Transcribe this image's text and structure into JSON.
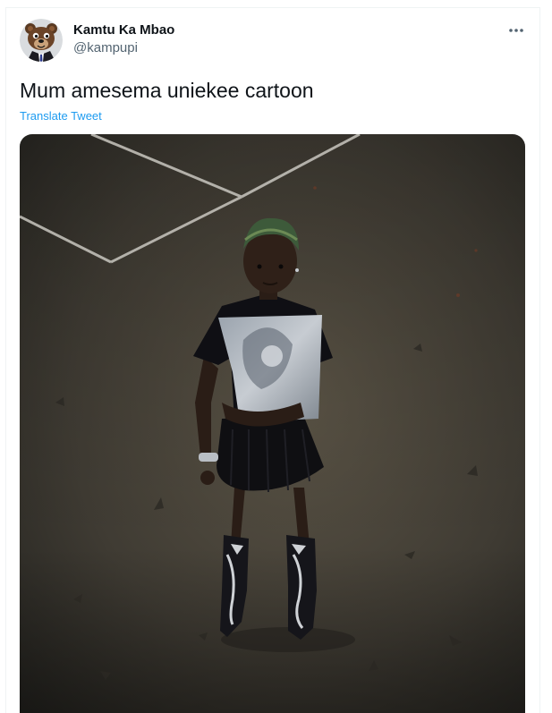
{
  "tweet": {
    "author": {
      "display_name": "Kamtu Ka Mbao",
      "handle": "@kampupi",
      "avatar_icon": "bear-avatar-icon"
    },
    "text": "Mum amesema uniekee cartoon",
    "translate_label": "Translate Tweet",
    "more_icon": "more-dots-icon",
    "media": {
      "kind": "photo",
      "subject": "person standing on a court"
    }
  },
  "colors": {
    "text_primary": "#0f1419",
    "text_secondary": "#536471",
    "link": "#1d9bf0",
    "border": "#eff3f4"
  }
}
